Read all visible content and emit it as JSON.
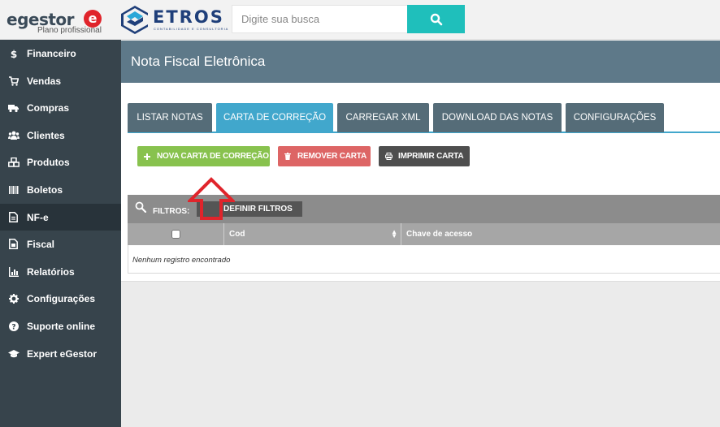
{
  "brand": {
    "name_main": "egestor",
    "name_badge": "e",
    "plan": "Plano profissional",
    "partner_name": "ETROS",
    "partner_sub": "CONTABILIDADE E CONSULTORIA"
  },
  "search": {
    "placeholder": "Digite sua busca",
    "value": ""
  },
  "colors": {
    "sidebar": "#37444c",
    "sidebar_active": "#28333a",
    "header": "#5e7989",
    "tab": "#556c78",
    "tab_active": "#41a7cc",
    "search_button": "#1fbfbb",
    "btn_green": "#88c24e",
    "btn_red": "#dd6565",
    "btn_dark": "#4e4e4e",
    "arrow": "#e0242b"
  },
  "sidebar": {
    "items": [
      {
        "label": "Financeiro",
        "icon": "dollar-icon"
      },
      {
        "label": "Vendas",
        "icon": "cart-icon"
      },
      {
        "label": "Compras",
        "icon": "truck-icon"
      },
      {
        "label": "Clientes",
        "icon": "users-icon"
      },
      {
        "label": "Produtos",
        "icon": "cubes-icon"
      },
      {
        "label": "Boletos",
        "icon": "barcode-icon"
      },
      {
        "label": "NF-e",
        "icon": "file-edit-icon",
        "active": true
      },
      {
        "label": "Fiscal",
        "icon": "file-icon"
      },
      {
        "label": "Relatórios",
        "icon": "bar-chart-icon"
      },
      {
        "label": "Configurações",
        "icon": "gear-icon"
      },
      {
        "label": "Suporte online",
        "icon": "question-icon"
      },
      {
        "label": "Expert eGestor",
        "icon": "graduation-cap-icon"
      }
    ]
  },
  "page": {
    "title": "Nota Fiscal Eletrônica"
  },
  "tabs": [
    {
      "label": "LISTAR NOTAS"
    },
    {
      "label": "CARTA DE CORREÇÃO",
      "active": true
    },
    {
      "label": "CARREGAR XML"
    },
    {
      "label": "DOWNLOAD DAS NOTAS"
    },
    {
      "label": "CONFIGURAÇÕES"
    }
  ],
  "actions": {
    "new": "NOVA CARTA DE CORREÇÃO",
    "remove": "REMOVER CARTA",
    "print": "IMPRIMIR CARTA"
  },
  "filters": {
    "label": "FILTROS:",
    "button": "DEFINIR FILTROS"
  },
  "table": {
    "columns": [
      "",
      "Cod",
      "Chave de acesso"
    ],
    "empty_message": "Nenhum registro encontrado"
  }
}
